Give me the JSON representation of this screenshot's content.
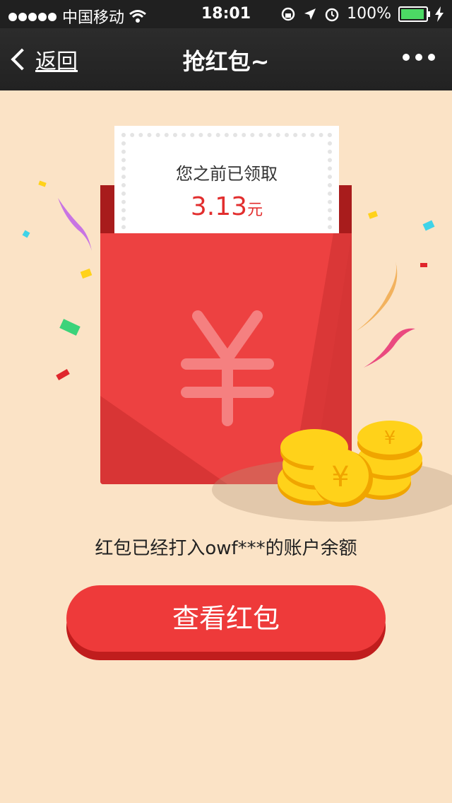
{
  "status_bar": {
    "carrier": "中国移动",
    "time": "18:01",
    "battery": "100%"
  },
  "nav": {
    "back_label": "返回",
    "title": "抢红包~"
  },
  "receipt": {
    "title": "您之前已领取",
    "amount": "3.13",
    "unit": "元"
  },
  "info_text": "红包已经打入owf***的账户余额",
  "view_button_label": "查看红包",
  "colors": {
    "background": "#fbe3c6",
    "envelope_red": "#e03a3a",
    "amount_red": "#e22e2e",
    "coin_gold": "#ffd21a"
  }
}
